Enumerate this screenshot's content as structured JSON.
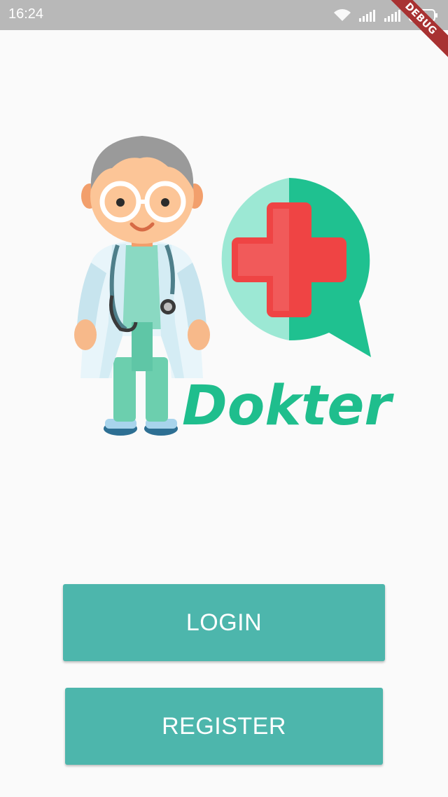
{
  "status_bar": {
    "time": "16:24",
    "icons": [
      "wifi-icon",
      "signal-icon",
      "signal-icon",
      "battery-icon"
    ]
  },
  "debug_banner": {
    "label": "DEBUG",
    "color": "#a83232"
  },
  "logo": {
    "text": "Dokter",
    "text_color": "#1fbe8d",
    "icons": [
      "doctor-illustration",
      "chat-bubble-cross-icon"
    ]
  },
  "actions": {
    "login_label": "LOGIN",
    "register_label": "REGISTER",
    "button_color": "#4db6ac"
  }
}
